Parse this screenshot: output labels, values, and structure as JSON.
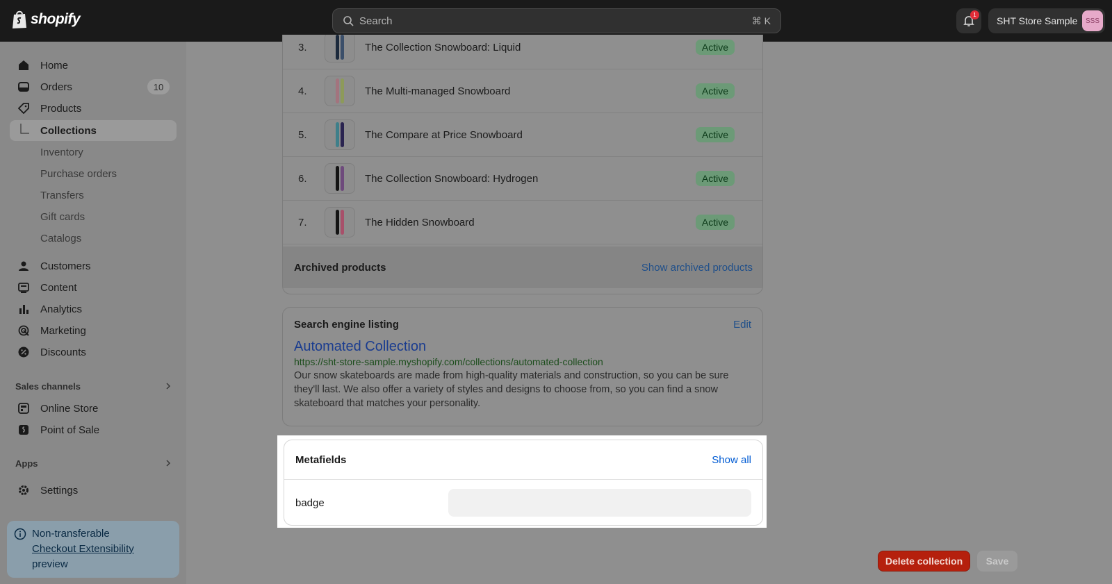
{
  "topbar": {
    "logo_text": "shopify",
    "search_placeholder": "Search",
    "search_shortcut": "⌘ K",
    "notification_count": "1",
    "store_name": "SHT Store Sample",
    "store_initials": "SSS"
  },
  "sidebar": {
    "items": [
      {
        "label": "Home",
        "icon": "home-icon"
      },
      {
        "label": "Orders",
        "icon": "orders-icon",
        "count": "10"
      },
      {
        "label": "Products",
        "icon": "tag-icon"
      },
      {
        "label": "Collections"
      },
      {
        "label": "Inventory"
      },
      {
        "label": "Purchase orders"
      },
      {
        "label": "Transfers"
      },
      {
        "label": "Gift cards"
      },
      {
        "label": "Catalogs"
      },
      {
        "label": "Customers",
        "icon": "person-icon"
      },
      {
        "label": "Content",
        "icon": "content-icon"
      },
      {
        "label": "Analytics",
        "icon": "bar-chart-icon"
      },
      {
        "label": "Marketing",
        "icon": "target-icon"
      },
      {
        "label": "Discounts",
        "icon": "discount-icon"
      }
    ],
    "sales_channels_label": "Sales channels",
    "channels": [
      {
        "label": "Online Store",
        "icon": "store-icon"
      },
      {
        "label": "Point of Sale",
        "icon": "pos-icon"
      }
    ],
    "apps_label": "Apps",
    "settings_label": "Settings",
    "notice": {
      "line1": "Non-transferable",
      "link": "Checkout Extensibility",
      "line3": "preview"
    }
  },
  "products": {
    "rows": [
      {
        "index": "3.",
        "name": "The Collection Snowboard: Liquid",
        "status": "Active"
      },
      {
        "index": "4.",
        "name": "The Multi-managed Snowboard",
        "status": "Active"
      },
      {
        "index": "5.",
        "name": "The Compare at Price Snowboard",
        "status": "Active"
      },
      {
        "index": "6.",
        "name": "The Collection Snowboard: Hydrogen",
        "status": "Active"
      },
      {
        "index": "7.",
        "name": "The Hidden Snowboard",
        "status": "Active"
      }
    ],
    "archived_label": "Archived products",
    "archived_link": "Show archived products"
  },
  "seo": {
    "heading": "Search engine listing",
    "edit_label": "Edit",
    "title": "Automated Collection",
    "url": "https://sht-store-sample.myshopify.com/collections/automated-collection",
    "description": "Our snow skateboards are made from high-quality materials and construction, so you can be sure they'll last. We also offer a variety of styles and designs to choose from, so you can find a snow skateboard that matches your personality."
  },
  "metafields": {
    "heading": "Metafields",
    "show_all": "Show all",
    "field_label": "badge",
    "field_value": ""
  },
  "actions": {
    "delete_label": "Delete collection",
    "save_label": "Save"
  },
  "colors": {
    "accent_link": "#005bd3",
    "active_badge": "#6c9a77",
    "danger": "#b5200d"
  }
}
